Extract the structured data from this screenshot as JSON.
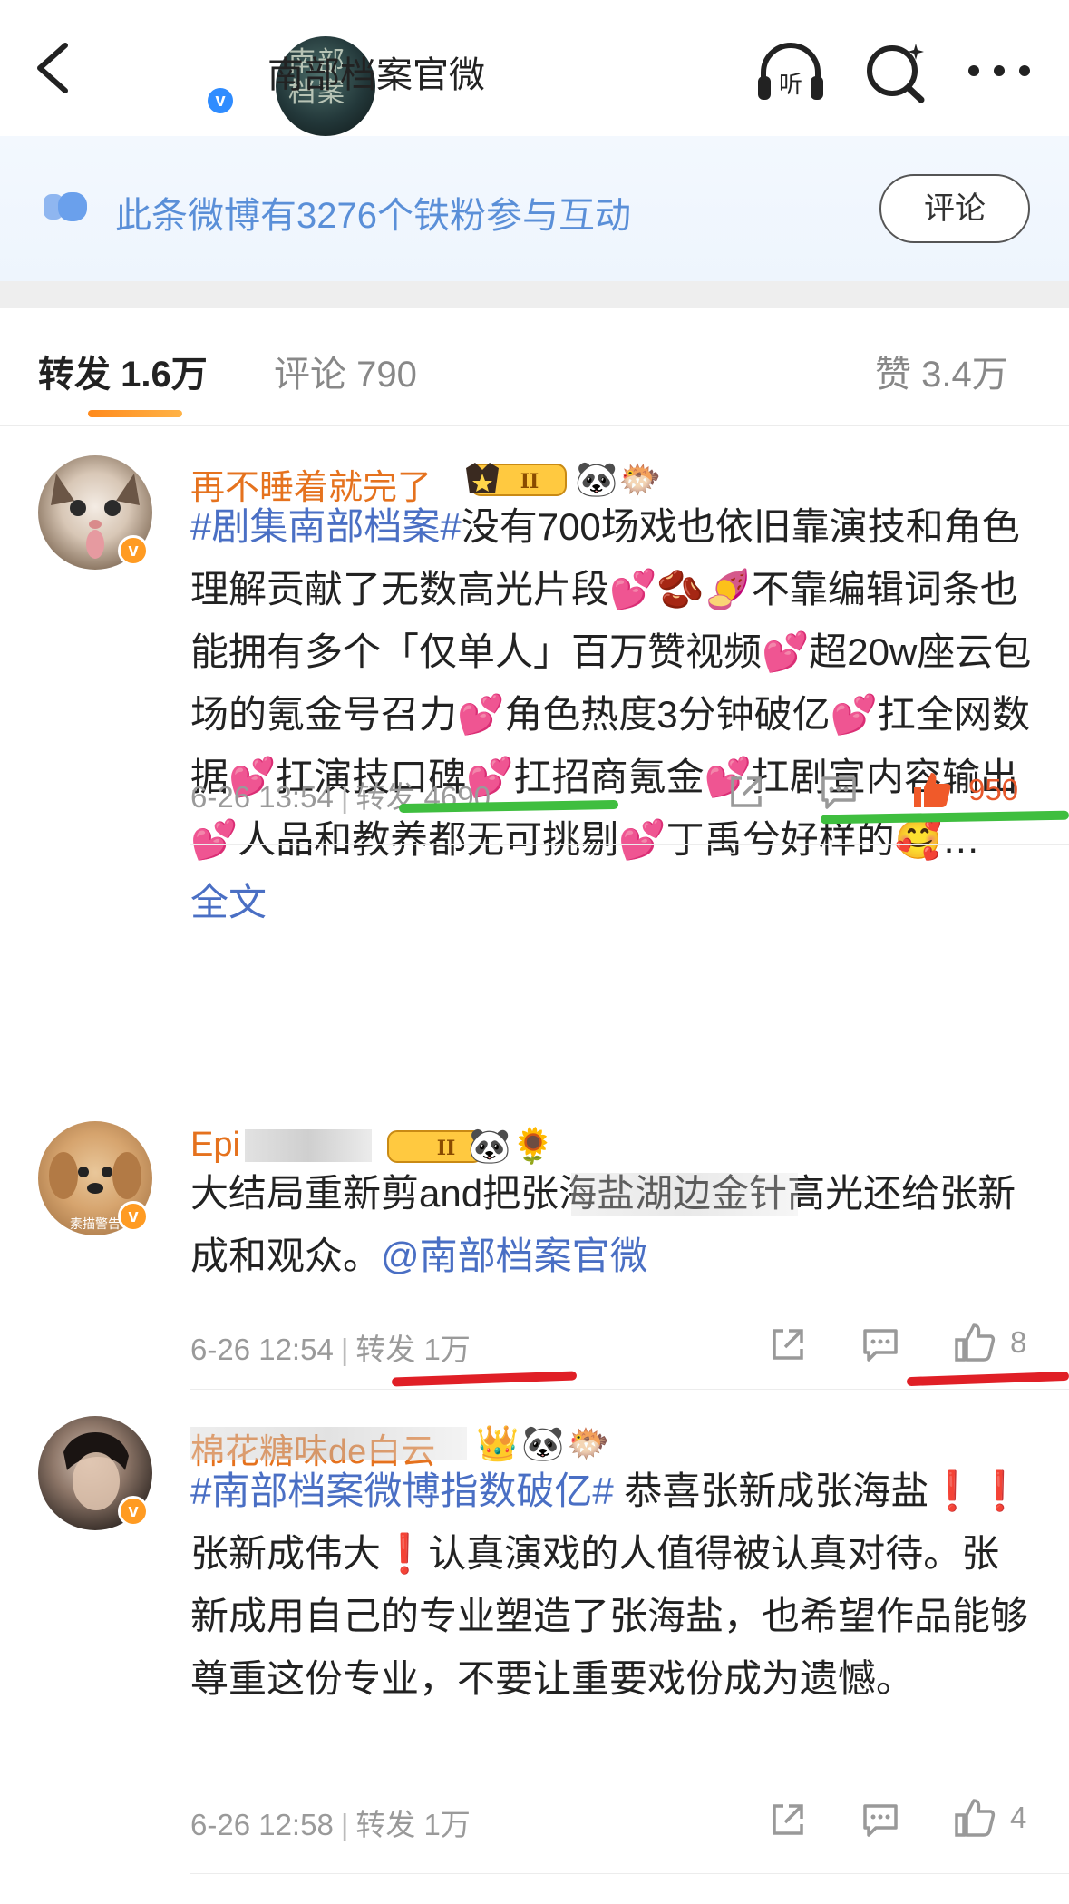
{
  "header": {
    "account_name": "南部档案官微",
    "avatar_text": "南部档案",
    "verified_mark": "v",
    "icons": [
      "back-arrow-icon",
      "listen-icon",
      "search-icon",
      "more-icon"
    ],
    "listen_label": "听"
  },
  "banner": {
    "text": "此条微博有3276个铁粉参与互动",
    "button": "评论"
  },
  "tabs": {
    "repost": "转发 1.6万",
    "comment": "评论 790",
    "like": "赞 3.4万"
  },
  "colors": {
    "username": "#e5721e",
    "link": "#4a6fc4",
    "accent": "#ff8a1c",
    "like_hot": "#e6582b"
  },
  "comments": [
    {
      "username": "再不睡着就完了",
      "badge_level": "II",
      "badge_emojis": [
        "🐼",
        "🐡"
      ],
      "text_parts": {
        "tag": "#剧集南部档案#",
        "text": "没有700场戏也依旧靠演技和角色理解贡献了无数高光片段💕🫘🍠不靠编辑词条也能拥有多个「仅单人」百万赞视频💕超20w座云包场的氪金号召力💕角色热度3分钟破亿💕扛全网数据💕扛演技口碑💕扛招商氪金💕扛剧宣内容输出💕人品和教养都无可挑剔💕丁禹兮好样的🥰…",
        "more": "全文"
      },
      "time": "6-26 13:54",
      "repost": "转发 4690",
      "likes": "950"
    },
    {
      "username": "Epi",
      "badge_level": "II",
      "badge_emojis": [
        "🐼",
        "🌻"
      ],
      "avatar_caption": "素描警告",
      "text_parts": {
        "text": "大结局重新剪and把张海盐湖边金针高光还给张新成和观众。",
        "mention": "@南部档案官微"
      },
      "time": "6-26 12:54",
      "repost": "转发 1万",
      "likes": "8"
    },
    {
      "username": "棉花糖味de白云",
      "badge_emojis": [
        "👑",
        "🐼",
        "🐡"
      ],
      "text_parts": {
        "tag": "#南部档案微博指数破亿#",
        "text": " 恭喜张新成张海盐❗️❗️张新成伟大❗️认真演戏的人值得被认真对待。张新成用自己的专业塑造了张海盐，也希望作品能够尊重这份专业，不要让重要戏份成为遗憾。"
      },
      "time": "6-26 12:58",
      "repost": "转发 1万",
      "likes": "4"
    }
  ]
}
